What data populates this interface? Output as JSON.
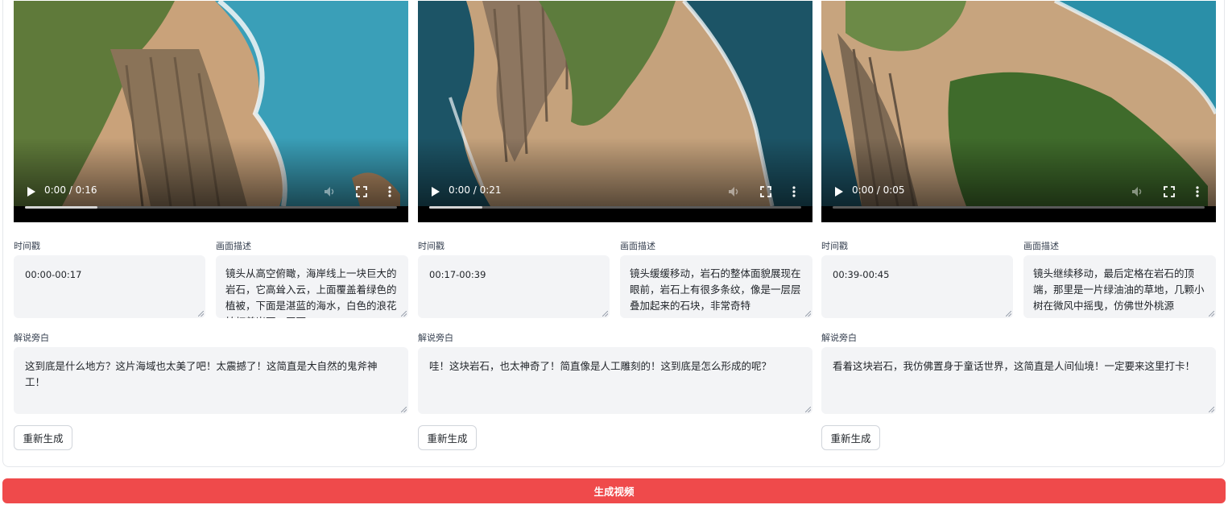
{
  "clips": [
    {
      "time_display": "0:00 / 0:16",
      "timestamp_label": "时间戳",
      "timestamp_value": "00:00-00:17",
      "description_label": "画面描述",
      "description_value": "镜头从高空俯瞰，海岸线上一块巨大的岩石，它高耸入云，上面覆盖着绿色的植被，下面是湛蓝的海水，白色的浪花拍打着岩石，画面",
      "narration_label": "解说旁白",
      "narration_value": "这到底是什么地方？这片海域也太美了吧！太震撼了！这简直是大自然的鬼斧神工！",
      "regenerate_label": "重新生成"
    },
    {
      "time_display": "0:00 / 0:21",
      "timestamp_label": "时间戳",
      "timestamp_value": "00:17-00:39",
      "description_label": "画面描述",
      "description_value": "镜头缓缓移动，岩石的整体面貌展现在眼前，岩石上有很多条纹，像是一层层叠加起来的石块，非常奇特",
      "narration_label": "解说旁白",
      "narration_value": "哇！这块岩石，也太神奇了！简直像是人工雕刻的！这到底是怎么形成的呢？",
      "regenerate_label": "重新生成"
    },
    {
      "time_display": "0:00 / 0:05",
      "timestamp_label": "时间戳",
      "timestamp_value": "00:39-00:45",
      "description_label": "画面描述",
      "description_value": "镜头继续移动，最后定格在岩石的顶端，那里是一片绿油油的草地，几颗小树在微风中摇曳，仿佛世外桃源",
      "narration_label": "解说旁白",
      "narration_value": "看着这块岩石，我仿佛置身于童话世界，这简直是人间仙境！一定要来这里打卡！",
      "regenerate_label": "重新生成"
    }
  ],
  "generate_button_label": "生成视频",
  "colors": {
    "accent": "#ef4a4b",
    "field_bg": "#f3f4f6",
    "sea": "#2a8fa8"
  }
}
